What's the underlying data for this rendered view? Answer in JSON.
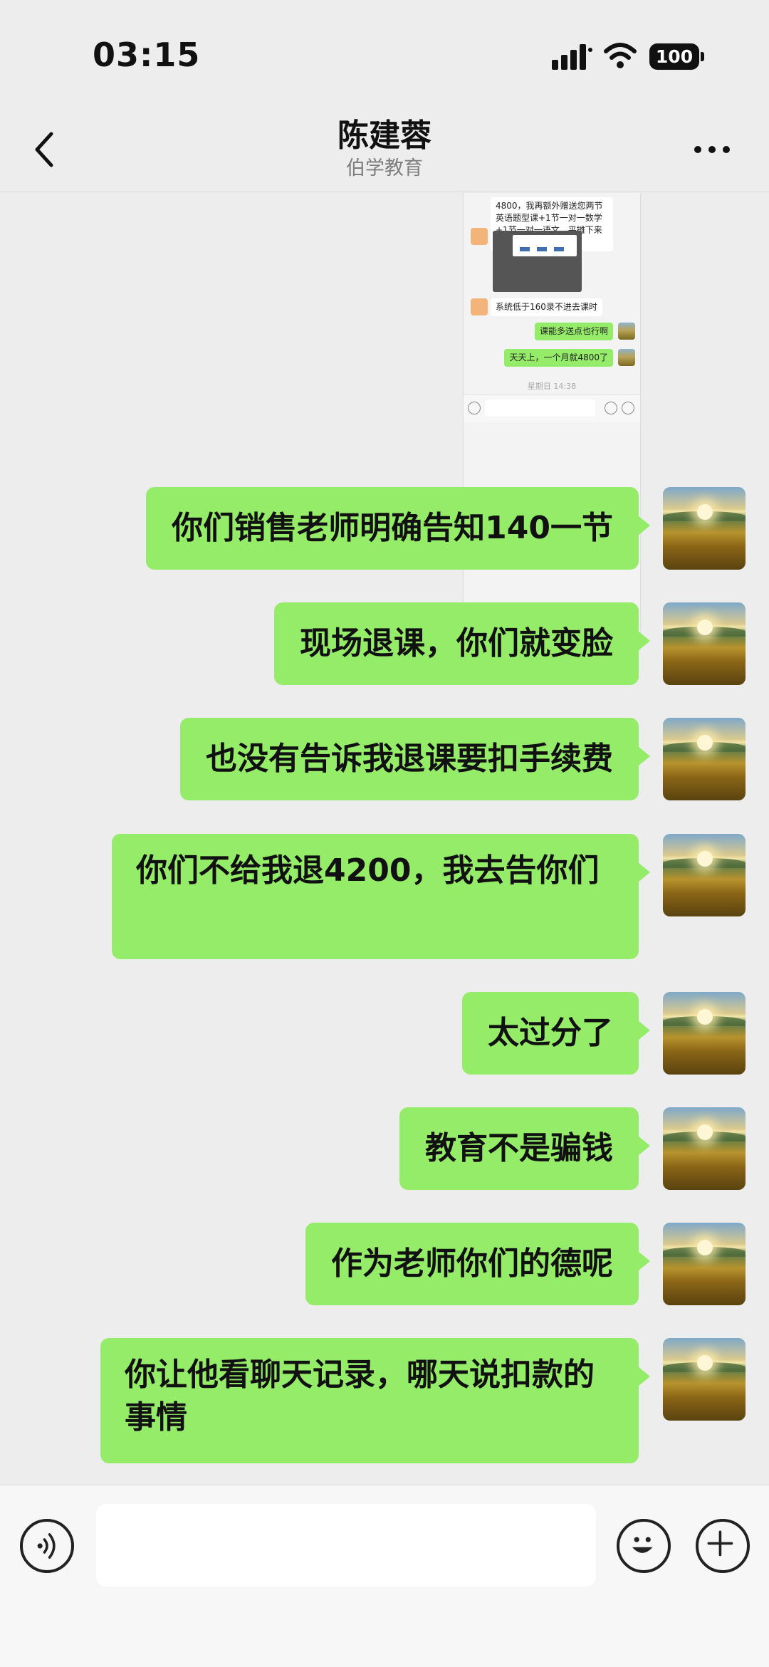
{
  "status_bar": {
    "time": "03:15",
    "battery": "100"
  },
  "header": {
    "title": "陈建蓉",
    "subtitle": "伯学教育"
  },
  "embedded_screenshot": {
    "messages": [
      {
        "text": "4800，我再额外赠送您两节英语题型课+1节一对一数学+1节一对一语文，平摊下来141一个课时了",
        "side": "left"
      },
      {
        "text": "系统低于160录不进去课时",
        "side": "left"
      },
      {
        "text": "课能多送点也行啊",
        "side": "right"
      },
      {
        "text": "天天上，一个月就4800了",
        "side": "right"
      }
    ],
    "timestamp": "星期日 14:38"
  },
  "messages": [
    {
      "text": "你们销售老师明确告知140一节"
    },
    {
      "text": "现场退课，你们就变脸"
    },
    {
      "text": "也没有告诉我退课要扣手续费"
    },
    {
      "text": "你们不给我退4200，我去告你们"
    },
    {
      "text": "太过分了"
    },
    {
      "text": "教育不是骗钱"
    },
    {
      "text": "作为老师你们的德呢"
    },
    {
      "text": "你让他看聊天记录，哪天说扣款的事情"
    }
  ],
  "colors": {
    "bubble_green": "#95ec69",
    "background": "#ededed"
  }
}
